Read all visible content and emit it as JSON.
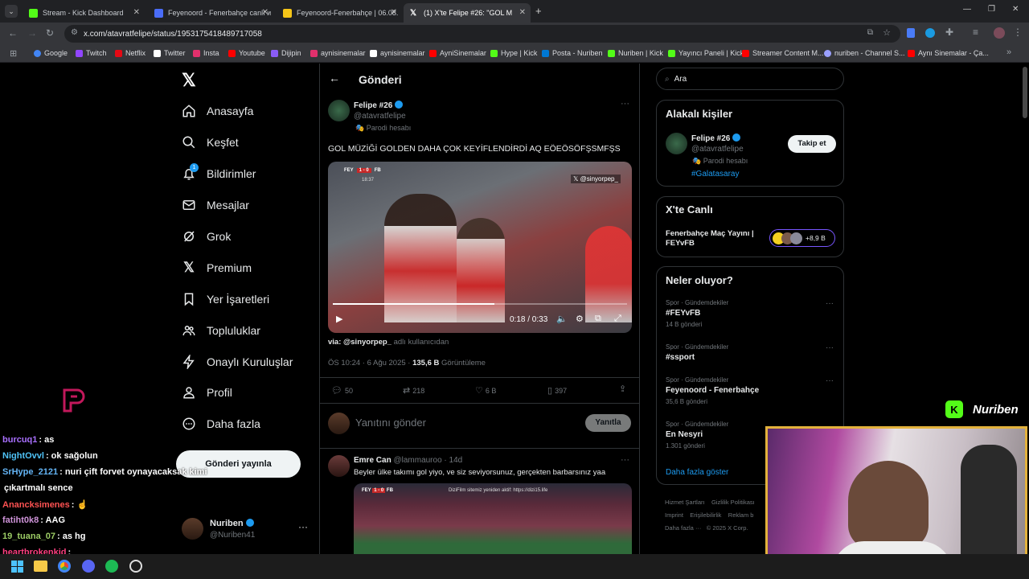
{
  "tabs": [
    {
      "title": "Stream - Kick Dashboard",
      "color": "#53fc18"
    },
    {
      "title": "Feyenoord - Fenerbahçe canlı и",
      "color": "#4a6cf7"
    },
    {
      "title": "Feyenoord-Fenerbahçe | 06.08.",
      "color": "#f5c518"
    },
    {
      "title": "(1) X'te Felipe #26: \"GOL M",
      "color": "#ffffff"
    }
  ],
  "url": "x.com/atavratfelipe/status/1953175418489717058",
  "bookmarks": [
    "Google",
    "Twitch",
    "Netflix",
    "Twitter",
    "Insta",
    "Youtube",
    "Dijipin",
    "aynisinemalar",
    "aynisinemalar",
    "AyniSinemalar",
    "Hype | Kick",
    "Posta - Nuriben",
    "Nuriben | Kick",
    "Yayıncı Paneli | Kick",
    "Streamer Content M...",
    "nuriben - Channel S...",
    "Aynı Sinemalar - Ça..."
  ],
  "nav": {
    "home": "Anasayfa",
    "explore": "Keşfet",
    "notifications": "Bildirimler",
    "notif_count": "1",
    "messages": "Mesajlar",
    "grok": "Grok",
    "premium": "Premium",
    "bookmarks": "Yer İşaretleri",
    "communities": "Topluluklar",
    "verified_orgs": "Onaylı Kuruluşlar",
    "profile": "Profil",
    "more": "Daha fazla",
    "post_button": "Gönderi yayınla",
    "account_name": "Nuriben",
    "account_handle": "@Nuriben41"
  },
  "header": {
    "title": "Gönderi"
  },
  "post": {
    "author": "Felipe #26",
    "handle": "@atavratfelipe",
    "parody": "Parodi hesabı",
    "text": "GOL MÜZİĞİ GOLDEN DAHA ÇOK KEYİFLENDİRDİ AQ EÖEÖSÖFŞSMFŞS",
    "video_time": "0:18 / 0:33",
    "video_progress": 0.55,
    "video_watermark": "@sinyorpep_",
    "score_team1": "FEY",
    "score": "1 - 0",
    "score_team2": "FB",
    "score_clock": "18:37",
    "via_handle": "via: @sinyorpep_",
    "via_suffix": "adlı kullanıcıdan",
    "timestamp": "ÖS 10:24 · 6 Ağu 2025 ·",
    "views": "135,6 B",
    "views_label": "Görüntüleme",
    "replies": "50",
    "reposts": "218",
    "likes": "6 B",
    "bookmarks": "397",
    "reply_placeholder": "Yanıtını gönder",
    "reply_button": "Yanıtla"
  },
  "reply": {
    "author": "Emre Can",
    "handle": "@lammauroo",
    "time": "· 14d",
    "text": "Beyler ülke takımı gol yiyo, ve siz seviyorsunuz, gerçekten barbarsınız yaa",
    "media_caption": "DiziFilm sitemiz yeniden aktif: https://dizi15.life"
  },
  "search": {
    "placeholder": "Ara"
  },
  "related": {
    "title": "Alakalı kişiler",
    "name": "Felipe #26",
    "handle": "@atavratfelipe",
    "parody": "Parodi hesabı",
    "tag": "#Galatasaray",
    "follow": "Takip et"
  },
  "live": {
    "title": "X'te Canlı",
    "event": "Fenerbahçe Maç Yayını | FEYvFB",
    "count": "+8,9 B"
  },
  "trends": {
    "title": "Neler oluyor?",
    "items": [
      {
        "category": "Spor · Gündemdekiler",
        "name": "#FEYvFB",
        "count": "14 B gönderi"
      },
      {
        "category": "Spor · Gündemdekiler",
        "name": "#ssport",
        "count": ""
      },
      {
        "category": "Spor · Gündemdekiler",
        "name": "Feyenoord - Fenerbahçe",
        "count": "35,6 B gönderi"
      },
      {
        "category": "Spor · Gündemdekiler",
        "name": "En Nesyri",
        "count": "1.301 gönderi"
      }
    ],
    "more": "Daha fazla göster"
  },
  "footer": [
    "Hizmet Şartları",
    "Gizlilik Politikası",
    "Imprint",
    "Erişilebilirlik",
    "Reklam b",
    "Daha fazla ···",
    "© 2025 X Corp."
  ],
  "overlay": {
    "streamer_name": "Nuriben"
  },
  "chat": [
    {
      "user": "burcuq1",
      "msg": ": as",
      "color": "#a970ff"
    },
    {
      "user": "NightOvvl",
      "msg": ": ok sağolun",
      "color": "#4fc3f7"
    },
    {
      "user": "SrHype_2121",
      "msg": ": nuri çift forvet oynayacaksak kimi",
      "color": "#64b5f6"
    },
    {
      "user": "",
      "msg": "çıkartmalı sence",
      "color": "#fff"
    },
    {
      "user": "Anancksimenes",
      "msg": ": ☝",
      "color": "#ff5252"
    },
    {
      "user": "fatiht0k8",
      "msg": ": AAG",
      "color": "#ce93d8"
    },
    {
      "user": "19_tuana_07",
      "msg": ": as hg",
      "color": "#9ccc65"
    },
    {
      "user": "heartbrokenkid",
      "msg": ":",
      "color": "#ff4081"
    }
  ]
}
